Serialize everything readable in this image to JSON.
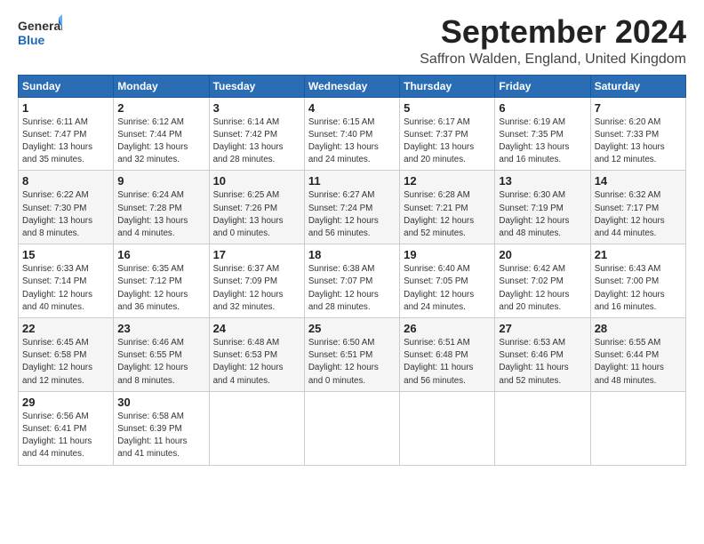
{
  "logo": {
    "line1": "General",
    "line2": "Blue"
  },
  "title": "September 2024",
  "subtitle": "Saffron Walden, England, United Kingdom",
  "days_header": [
    "Sunday",
    "Monday",
    "Tuesday",
    "Wednesday",
    "Thursday",
    "Friday",
    "Saturday"
  ],
  "weeks": [
    [
      {
        "day": "1",
        "info": "Sunrise: 6:11 AM\nSunset: 7:47 PM\nDaylight: 13 hours\nand 35 minutes."
      },
      {
        "day": "2",
        "info": "Sunrise: 6:12 AM\nSunset: 7:44 PM\nDaylight: 13 hours\nand 32 minutes."
      },
      {
        "day": "3",
        "info": "Sunrise: 6:14 AM\nSunset: 7:42 PM\nDaylight: 13 hours\nand 28 minutes."
      },
      {
        "day": "4",
        "info": "Sunrise: 6:15 AM\nSunset: 7:40 PM\nDaylight: 13 hours\nand 24 minutes."
      },
      {
        "day": "5",
        "info": "Sunrise: 6:17 AM\nSunset: 7:37 PM\nDaylight: 13 hours\nand 20 minutes."
      },
      {
        "day": "6",
        "info": "Sunrise: 6:19 AM\nSunset: 7:35 PM\nDaylight: 13 hours\nand 16 minutes."
      },
      {
        "day": "7",
        "info": "Sunrise: 6:20 AM\nSunset: 7:33 PM\nDaylight: 13 hours\nand 12 minutes."
      }
    ],
    [
      {
        "day": "8",
        "info": "Sunrise: 6:22 AM\nSunset: 7:30 PM\nDaylight: 13 hours\nand 8 minutes."
      },
      {
        "day": "9",
        "info": "Sunrise: 6:24 AM\nSunset: 7:28 PM\nDaylight: 13 hours\nand 4 minutes."
      },
      {
        "day": "10",
        "info": "Sunrise: 6:25 AM\nSunset: 7:26 PM\nDaylight: 13 hours\nand 0 minutes."
      },
      {
        "day": "11",
        "info": "Sunrise: 6:27 AM\nSunset: 7:24 PM\nDaylight: 12 hours\nand 56 minutes."
      },
      {
        "day": "12",
        "info": "Sunrise: 6:28 AM\nSunset: 7:21 PM\nDaylight: 12 hours\nand 52 minutes."
      },
      {
        "day": "13",
        "info": "Sunrise: 6:30 AM\nSunset: 7:19 PM\nDaylight: 12 hours\nand 48 minutes."
      },
      {
        "day": "14",
        "info": "Sunrise: 6:32 AM\nSunset: 7:17 PM\nDaylight: 12 hours\nand 44 minutes."
      }
    ],
    [
      {
        "day": "15",
        "info": "Sunrise: 6:33 AM\nSunset: 7:14 PM\nDaylight: 12 hours\nand 40 minutes."
      },
      {
        "day": "16",
        "info": "Sunrise: 6:35 AM\nSunset: 7:12 PM\nDaylight: 12 hours\nand 36 minutes."
      },
      {
        "day": "17",
        "info": "Sunrise: 6:37 AM\nSunset: 7:09 PM\nDaylight: 12 hours\nand 32 minutes."
      },
      {
        "day": "18",
        "info": "Sunrise: 6:38 AM\nSunset: 7:07 PM\nDaylight: 12 hours\nand 28 minutes."
      },
      {
        "day": "19",
        "info": "Sunrise: 6:40 AM\nSunset: 7:05 PM\nDaylight: 12 hours\nand 24 minutes."
      },
      {
        "day": "20",
        "info": "Sunrise: 6:42 AM\nSunset: 7:02 PM\nDaylight: 12 hours\nand 20 minutes."
      },
      {
        "day": "21",
        "info": "Sunrise: 6:43 AM\nSunset: 7:00 PM\nDaylight: 12 hours\nand 16 minutes."
      }
    ],
    [
      {
        "day": "22",
        "info": "Sunrise: 6:45 AM\nSunset: 6:58 PM\nDaylight: 12 hours\nand 12 minutes."
      },
      {
        "day": "23",
        "info": "Sunrise: 6:46 AM\nSunset: 6:55 PM\nDaylight: 12 hours\nand 8 minutes."
      },
      {
        "day": "24",
        "info": "Sunrise: 6:48 AM\nSunset: 6:53 PM\nDaylight: 12 hours\nand 4 minutes."
      },
      {
        "day": "25",
        "info": "Sunrise: 6:50 AM\nSunset: 6:51 PM\nDaylight: 12 hours\nand 0 minutes."
      },
      {
        "day": "26",
        "info": "Sunrise: 6:51 AM\nSunset: 6:48 PM\nDaylight: 11 hours\nand 56 minutes."
      },
      {
        "day": "27",
        "info": "Sunrise: 6:53 AM\nSunset: 6:46 PM\nDaylight: 11 hours\nand 52 minutes."
      },
      {
        "day": "28",
        "info": "Sunrise: 6:55 AM\nSunset: 6:44 PM\nDaylight: 11 hours\nand 48 minutes."
      }
    ],
    [
      {
        "day": "29",
        "info": "Sunrise: 6:56 AM\nSunset: 6:41 PM\nDaylight: 11 hours\nand 44 minutes."
      },
      {
        "day": "30",
        "info": "Sunrise: 6:58 AM\nSunset: 6:39 PM\nDaylight: 11 hours\nand 41 minutes."
      },
      {
        "day": "",
        "info": ""
      },
      {
        "day": "",
        "info": ""
      },
      {
        "day": "",
        "info": ""
      },
      {
        "day": "",
        "info": ""
      },
      {
        "day": "",
        "info": ""
      }
    ]
  ]
}
